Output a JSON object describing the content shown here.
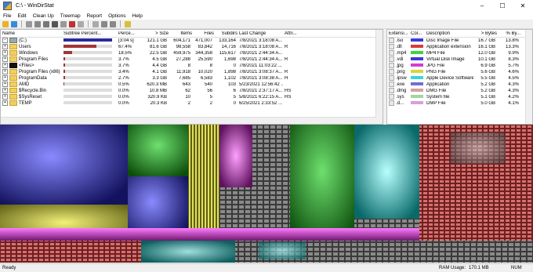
{
  "window": {
    "title": "C:\\ - WinDirStat",
    "minimize": "–",
    "maximize": "☐",
    "close": "✕"
  },
  "menu": [
    "File",
    "Edit",
    "Clean Up",
    "Treemap",
    "Report",
    "Options",
    "Help"
  ],
  "tree": {
    "columns": [
      "Name",
      "Subtree Percent...",
      "Perce...",
      "> Size",
      "Items",
      "Files",
      "Subdirs",
      "Last Change",
      "Attri..."
    ],
    "rows": [
      {
        "name": "(C:)",
        "expander": "−",
        "type": "drive",
        "subtree": 100,
        "percent": "[3:04 s]",
        "size": "121.1 GB",
        "items": "604,171",
        "files": "471,007",
        "subdirs": "133,164",
        "last_change": "7/8/2021 3:18:08 A...",
        "attr": ""
      },
      {
        "name": "Users",
        "expander": "+",
        "type": "folder",
        "subtree": 67.4,
        "percent": "67.4%",
        "size": "81.6 GB",
        "items": "98,558",
        "files": "83,842",
        "subdirs": "14,716",
        "last_change": "7/8/2021 3:18:08 A...",
        "attr": "R"
      },
      {
        "name": "Windows",
        "expander": "+",
        "type": "folder",
        "subtree": 18.5,
        "percent": "18.5%",
        "size": "22.5 GB",
        "items": "459,975",
        "files": "344,358",
        "subdirs": "115,617",
        "last_change": "7/8/2021 2:44:34 A...",
        "attr": ""
      },
      {
        "name": "Program Files",
        "expander": "+",
        "type": "folder",
        "subtree": 3.7,
        "percent": "3.7%",
        "size": "4.5 GB",
        "items": "27,288",
        "files": "25,590",
        "subdirs": "1,698",
        "last_change": "7/8/2021 2:44:34 A...",
        "attr": "R"
      },
      {
        "name": "<Files>",
        "expander": "+",
        "type": "files",
        "subtree": 3.7,
        "percent": "3.7%",
        "size": "4.4 GB",
        "items": "8",
        "files": "8",
        "subdirs": "0",
        "last_change": "7/8/2021 11:03:22 ...",
        "attr": ""
      },
      {
        "name": "Program Files (x86)",
        "expander": "+",
        "type": "folder",
        "subtree": 3.4,
        "percent": "3.4%",
        "size": "4.1 GB",
        "items": "11,918",
        "files": "10,020",
        "subdirs": "1,898",
        "last_change": "7/8/2021 3:08:37 A...",
        "attr": "R"
      },
      {
        "name": "ProgramData",
        "expander": "+",
        "type": "folder",
        "subtree": 2.7,
        "percent": "2.7%",
        "size": "3.3 GB",
        "items": "7,685",
        "files": "6,583",
        "subdirs": "1,102",
        "last_change": "7/8/2021 3:08:38 A...",
        "attr": "H"
      },
      {
        "name": "AMD",
        "expander": "+",
        "type": "folder",
        "subtree": 0.5,
        "percent": "0.5%",
        "size": "620.3 MB",
        "items": "643",
        "files": "540",
        "subdirs": "103",
        "last_change": "5/23/2021 12:56:42 ...",
        "attr": ""
      },
      {
        "name": "$Recycle.Bin",
        "expander": "+",
        "type": "folder",
        "subtree": 0.0,
        "percent": "0.0%",
        "size": "10.8 MB",
        "items": "62",
        "files": "56",
        "subdirs": "6",
        "last_change": "7/8/2021 2:37:17 A...",
        "attr": "HS"
      },
      {
        "name": "$SysReset",
        "expander": "+",
        "type": "folder",
        "subtree": 0.0,
        "percent": "0.0%",
        "size": "320.9 KB",
        "items": "10",
        "files": "5",
        "subdirs": "5",
        "last_change": "5/8/2021 6:22:15 A...",
        "attr": "HS"
      },
      {
        "name": "TEMP",
        "expander": "+",
        "type": "folder",
        "subtree": 0.0,
        "percent": "0.0%",
        "size": "20.3 KB",
        "items": "2",
        "files": "2",
        "subdirs": "0",
        "last_change": "6/25/2021 2:33:52 ...",
        "attr": ""
      }
    ]
  },
  "extensions": {
    "columns": [
      "Extensi...",
      "Col...",
      "Description",
      "> Bytes",
      "% By..."
    ],
    "rows": [
      {
        "ext": ".iso",
        "color": "#3b3bd6",
        "desc": "Disc Image File",
        "bytes": "16.7 GB",
        "pct": "13.8%"
      },
      {
        "ext": ".dll",
        "color": "#d63b3b",
        "desc": "Application extension",
        "bytes": "16.1 GB",
        "pct": "13.3%"
      },
      {
        "ext": ".mp4",
        "color": "#3bd63b",
        "desc": "MP4 File",
        "bytes": "12.0 GB",
        "pct": "9.9%"
      },
      {
        "ext": ".vdi",
        "color": "#3b3bd6",
        "desc": "Virtual Disk Image",
        "bytes": "10.1 GB",
        "pct": "8.3%"
      },
      {
        "ext": ".jpg",
        "color": "#d63bd6",
        "desc": "JPG File",
        "bytes": "6.9 GB",
        "pct": "5.7%"
      },
      {
        "ext": ".png",
        "color": "#d6d63b",
        "desc": "PNG File",
        "bytes": "5.6 GB",
        "pct": "4.6%"
      },
      {
        "ext": ".ipsw",
        "color": "#3bd6d6",
        "desc": "Apple Device Software Upda...",
        "bytes": "5.5 GB",
        "pct": "4.5%"
      },
      {
        "ext": ".exe",
        "color": "#6e6ed6",
        "desc": "Application",
        "bytes": "5.2 GB",
        "pct": "4.3%"
      },
      {
        "ext": ".dmg",
        "color": "#d6a0a0",
        "desc": "DMG File",
        "bytes": "5.2 GB",
        "pct": "4.3%"
      },
      {
        "ext": ".sys",
        "color": "#a0d6a0",
        "desc": "System file",
        "bytes": "5.1 GB",
        "pct": "4.2%"
      },
      {
        "ext": ".d...",
        "color": "#d6a0d6",
        "desc": "DMP File",
        "bytes": "5.0 GB",
        "pct": "4.1%"
      }
    ]
  },
  "status": {
    "left": "Ready",
    "ram_label": "RAM Usage:",
    "ram_value": "170.1 MB",
    "num": "NUM"
  }
}
